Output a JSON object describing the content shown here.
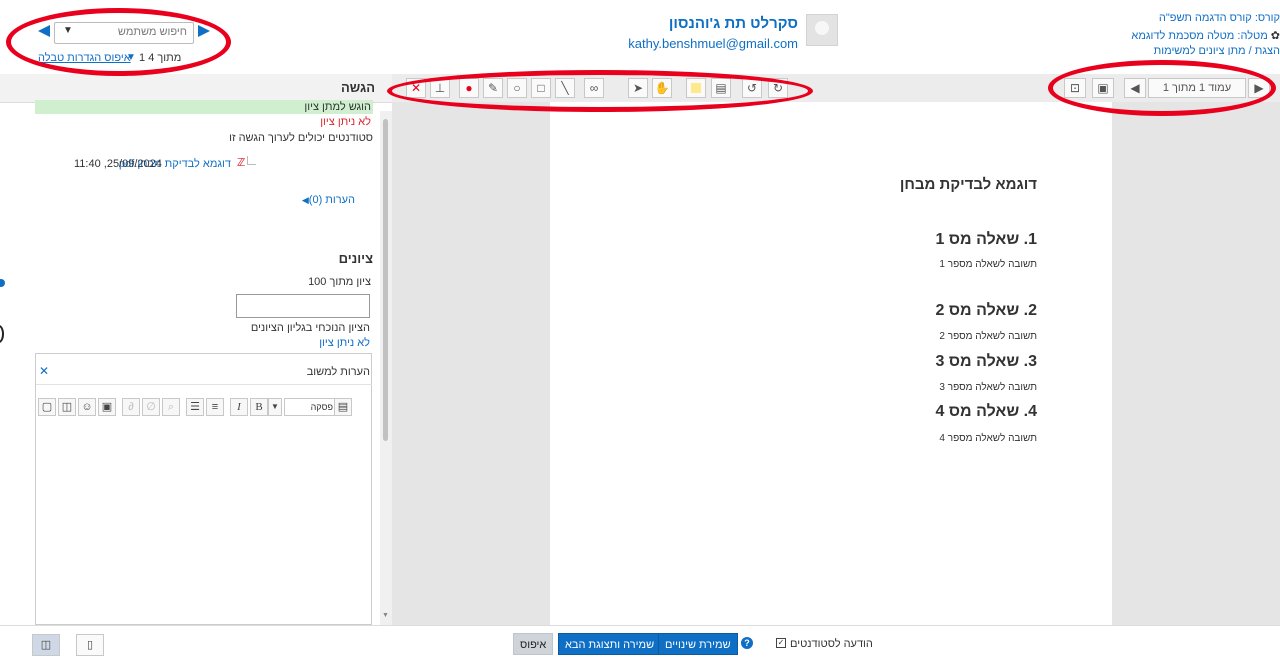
{
  "header": {
    "course": "קורס: קורס הדגמה תשפ\"ה",
    "assignment": "מטלה: מטלה מסכמת לדוגמא",
    "view_link": "הצגת / מתן ציונים למשימות",
    "user_name": "סקרלט תת ג'והנסון",
    "user_email": "kathy.benshmuel@gmail.com",
    "user_search_placeholder": "חיפוש משתמש",
    "user_count": "1 מתוך 4",
    "reset_filters": "איפוס הגדרות טבלה"
  },
  "submission": {
    "heading": "הגשה",
    "status_submitted": "הוגש למתן ציון",
    "status_not_graded": "לא ניתן ציון",
    "students_can_edit": "סטודנטים יכולים לערוך הגשה זו",
    "file_name": "דוגמא לבדיקת מבחן.pdf",
    "file_date": "11:40 ,25/09/2024",
    "comments": "הערות (0)"
  },
  "grades": {
    "heading": "ציונים",
    "grade_out_of": "ציון מתוך 100",
    "current_gradebook": "הציון הנוכחי בגליון הציונים",
    "not_graded": "לא ניתן ציון",
    "feedback_label": "הערות למשוב",
    "paragraph_select": "פסקה"
  },
  "viewer": {
    "page_indicator": "עמוד 1 מתוך 1",
    "document": {
      "title": "דוגמא לבדיקת מבחן",
      "questions": [
        {
          "heading": "1. שאלה מס 1",
          "answer": "תשובה לשאלה מספר 1"
        },
        {
          "heading": "2. שאלה מס 2",
          "answer": "תשובה לשאלה מספר 2"
        },
        {
          "heading": "3. שאלה מס 3",
          "answer": "תשובה לשאלה מספר 3"
        },
        {
          "heading": "4. שאלה מס 4",
          "answer": "תשובה לשאלה מספר 4"
        }
      ]
    }
  },
  "footer": {
    "notify_students": "הודעה לסטודנטים",
    "save_changes": "שמירת שינויים",
    "save_and_next": "שמירה ותצוגת הבא",
    "reset": "איפוס"
  },
  "colors": {
    "link": "#0f6fc5",
    "annotation_ring": "#e8001c",
    "status_green": "#cfefcf",
    "status_red": "#d9272e"
  },
  "icons": {
    "annotation_tools": [
      "delete-icon",
      "stamp-icon",
      "color-drop-icon",
      "pen-icon",
      "oval-icon",
      "rectangle-icon",
      "line-icon",
      "stamp-picker-icon",
      "select-icon",
      "pan-icon",
      "highlight-color-icon",
      "comment-icon",
      "rotate-left-icon",
      "rotate-right-icon"
    ]
  }
}
